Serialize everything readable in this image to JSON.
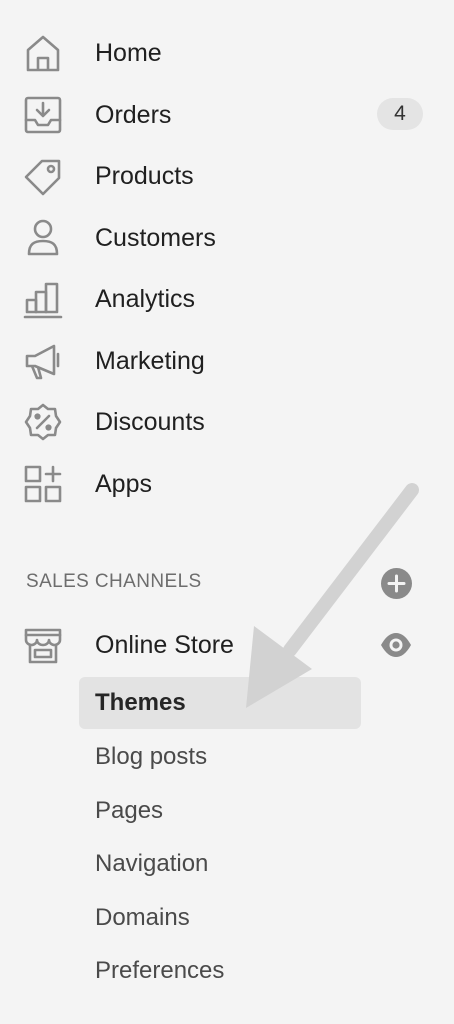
{
  "nav": {
    "items": [
      {
        "label": "Home",
        "icon": "home-icon"
      },
      {
        "label": "Orders",
        "icon": "orders-icon",
        "badge": "4"
      },
      {
        "label": "Products",
        "icon": "tag-icon"
      },
      {
        "label": "Customers",
        "icon": "person-icon"
      },
      {
        "label": "Analytics",
        "icon": "bar-chart-icon"
      },
      {
        "label": "Marketing",
        "icon": "megaphone-icon"
      },
      {
        "label": "Discounts",
        "icon": "discount-icon"
      },
      {
        "label": "Apps",
        "icon": "apps-icon"
      }
    ]
  },
  "sales_channels": {
    "header": "SALES CHANNELS",
    "online_store": {
      "label": "Online Store",
      "icon": "storefront-icon",
      "sub_items": [
        {
          "label": "Themes",
          "active": true
        },
        {
          "label": "Blog posts"
        },
        {
          "label": "Pages"
        },
        {
          "label": "Navigation"
        },
        {
          "label": "Domains"
        },
        {
          "label": "Preferences"
        }
      ]
    }
  },
  "colors": {
    "background": "#f4f4f4",
    "icon_gray": "#8a8a8a",
    "active_bg": "#e3e3e3",
    "arrow": "#d2d2d2"
  }
}
